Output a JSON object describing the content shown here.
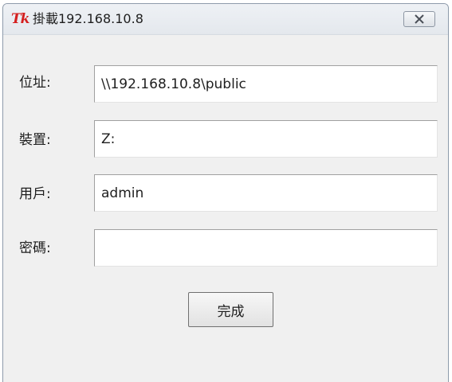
{
  "window": {
    "logo_text": "Tk",
    "title": "掛載192.168.10.8"
  },
  "form": {
    "address": {
      "label": "位址:",
      "value": "\\\\192.168.10.8\\public"
    },
    "device": {
      "label": "裝置:",
      "value": "Z:"
    },
    "user": {
      "label": "用戶:",
      "value": "admin"
    },
    "password": {
      "label": "密碼:",
      "value": ""
    }
  },
  "buttons": {
    "done_label": "完成"
  },
  "colors": {
    "logo": "#d42020",
    "window_bg": "#f0f0f0"
  }
}
